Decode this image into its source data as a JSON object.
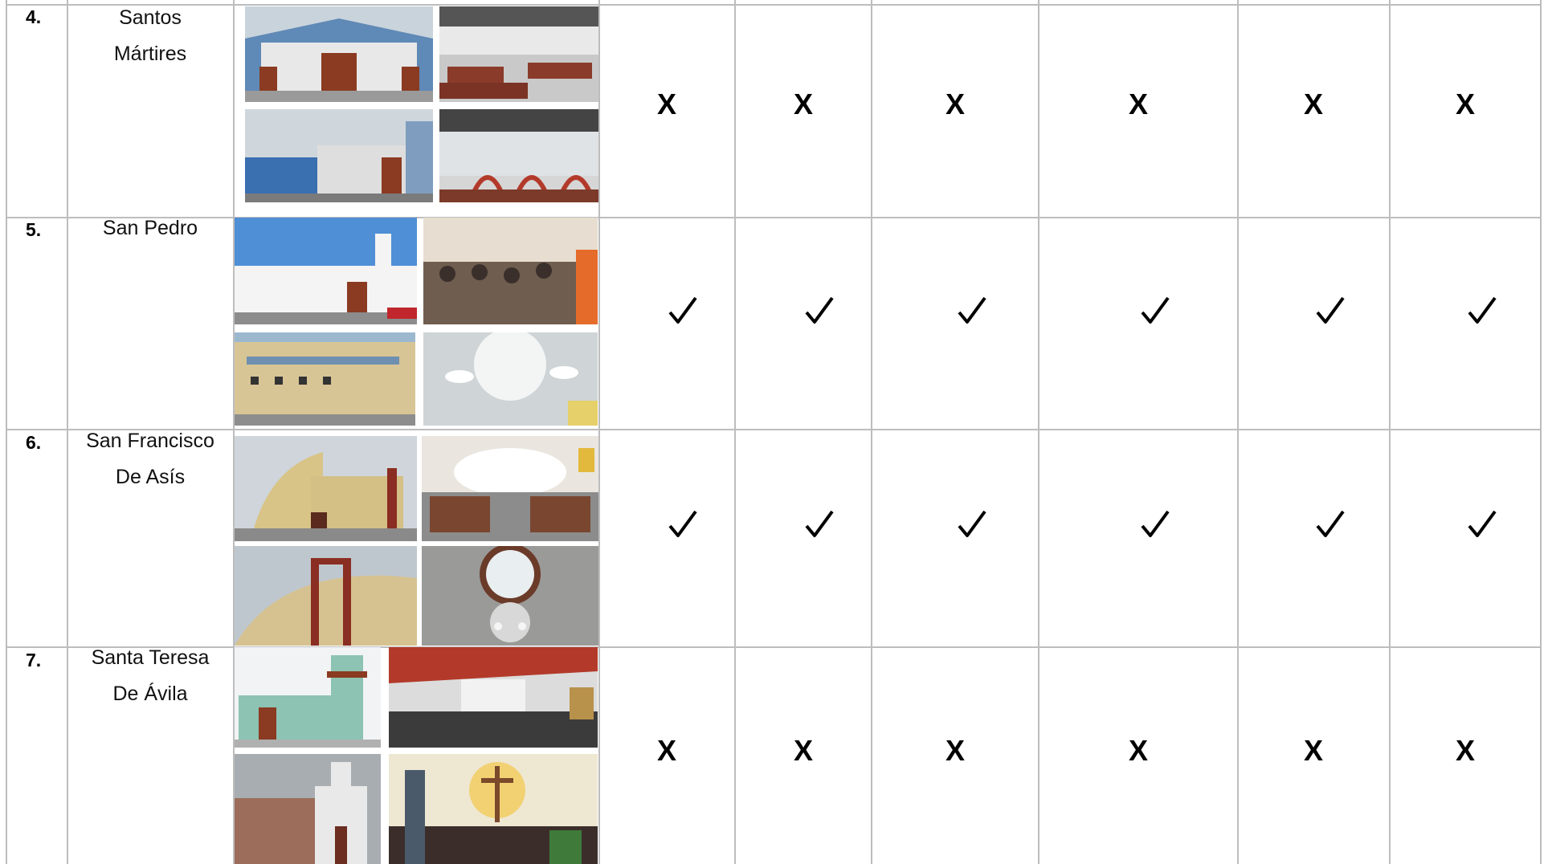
{
  "rows": [
    {
      "num": "4.",
      "name_line1": "Santos",
      "name_line2": "Mártires",
      "mark": "X",
      "photos": [
        "Santos Mártires church exterior facade",
        "Santos Mártires interior with pews",
        "Santos Mártires street side view",
        "Santos Mártires interior arches"
      ]
    },
    {
      "num": "5.",
      "name_line1": "San Pedro",
      "name_line2": "",
      "mark": "✓",
      "photos": [
        "San Pedro church exterior",
        "San Pedro interior with congregation",
        "San Pedro side building",
        "San Pedro interior ceiling lights"
      ]
    },
    {
      "num": "6.",
      "name_line1": "San Francisco",
      "name_line2": "De Asís",
      "mark": "✓",
      "photos": [
        "San Francisco de Asís curved exterior",
        "San Francisco de Asís nave and altar",
        "San Francisco de Asís bell tower",
        "San Francisco de Asís dome with chandelier"
      ]
    },
    {
      "num": "7.",
      "name_line1": "Santa Teresa",
      "name_line2": "De Ávila",
      "mark": "X",
      "photos": [
        "Santa Teresa de Ávila tower exterior",
        "Santa Teresa de Ávila interior with congregation",
        "Santa Teresa de Ávila street view",
        "Santa Teresa de Ávila altar with crucifix"
      ]
    }
  ],
  "colors": {
    "grid": "#bdbdbd",
    "mark": "#000000"
  }
}
